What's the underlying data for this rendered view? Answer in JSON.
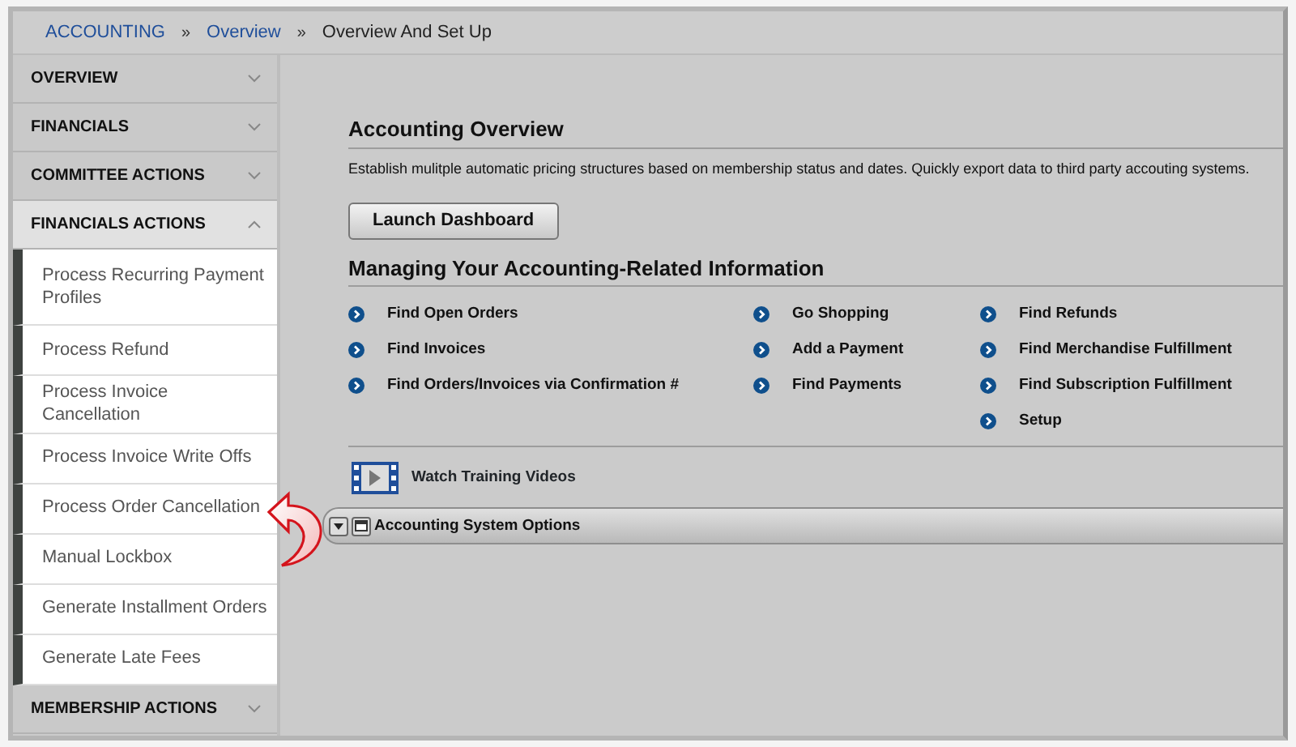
{
  "breadcrumb": [
    {
      "label": "ACCOUNTING",
      "kind": "link"
    },
    {
      "label": "»",
      "kind": "separator"
    },
    {
      "label": "Overview",
      "kind": "link"
    },
    {
      "label": "»",
      "kind": "separator"
    },
    {
      "label": "Overview And Set Up",
      "kind": "current"
    }
  ],
  "sidebar": {
    "sections": [
      {
        "label": "OVERVIEW",
        "expanded": false
      },
      {
        "label": "FINANCIALS",
        "expanded": false
      },
      {
        "label": "COMMITTEE ACTIONS",
        "expanded": false
      },
      {
        "label": "FINANCIALS ACTIONS",
        "expanded": true,
        "children": [
          {
            "label": "Process Recurring Payment Profiles"
          },
          {
            "label": "Process Refund"
          },
          {
            "label": "Process Invoice Cancellation"
          },
          {
            "label": "Process Invoice Write Offs"
          },
          {
            "label": "Process Order Cancellation",
            "highlighted": true
          },
          {
            "label": "Manual Lockbox"
          },
          {
            "label": "Generate Installment Orders"
          },
          {
            "label": "Generate Late Fees"
          }
        ]
      },
      {
        "label": "MEMBERSHIP ACTIONS",
        "expanded": false
      }
    ]
  },
  "overview": {
    "title": "Accounting Overview",
    "description": "Establish mulitple automatic pricing structures based on membership status and dates. Quickly export data to third party accouting systems.",
    "button": "Launch Dashboard"
  },
  "managing": {
    "title": "Managing Your Accounting-Related Information",
    "columns": [
      [
        "Find Open Orders",
        "Find Invoices",
        "Find Orders/Invoices via Confirmation #"
      ],
      [
        "Go Shopping",
        "Add a Payment",
        "Find Payments"
      ],
      [
        "Find Refunds",
        "Find Merchandise Fulfillment",
        "Find Subscription Fulfillment",
        "Setup"
      ]
    ]
  },
  "training": {
    "label": "Watch Training Videos"
  },
  "options_panel": {
    "title": "Accounting System Options",
    "expanded": false
  }
}
